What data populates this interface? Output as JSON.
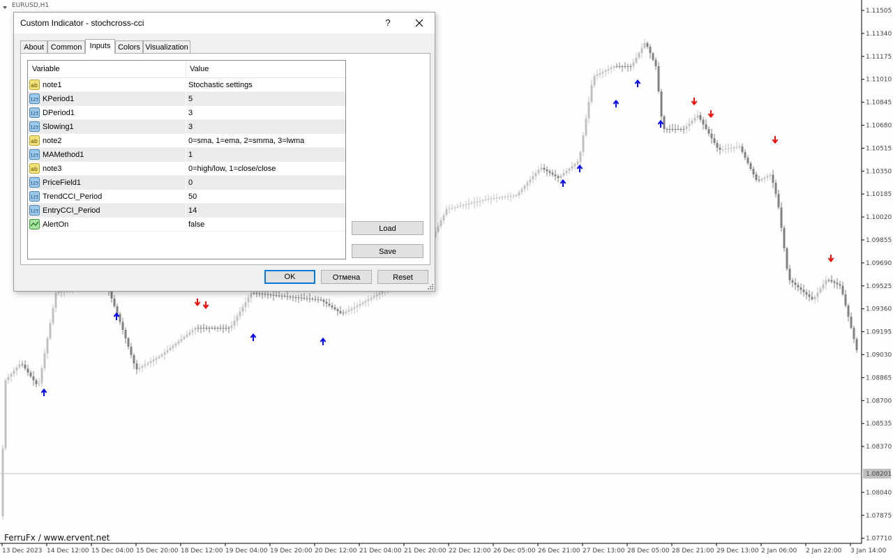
{
  "chart": {
    "symbol_label": "EURUSD,H1",
    "watermark": "FerruFx / www.ervent.net",
    "current_price": "1.08201",
    "price_labels": [
      "1.11505",
      "1.11340",
      "1.11175",
      "1.11010",
      "1.10845",
      "1.10680",
      "1.10515",
      "1.10350",
      "1.10185",
      "1.10020",
      "1.09855",
      "1.09690",
      "1.09525",
      "1.09360",
      "1.09195",
      "1.09030",
      "1.08865",
      "1.08700",
      "1.08535",
      "1.08370",
      "1.08040",
      "1.07875",
      "1.07710"
    ],
    "time_labels": [
      "13 Dec 2023",
      "14 Dec 12:00",
      "15 Dec 04:00",
      "15 Dec 20:00",
      "18 Dec 12:00",
      "19 Dec 04:00",
      "19 Dec 20:00",
      "20 Dec 12:00",
      "21 Dec 04:00",
      "21 Dec 20:00",
      "22 Dec 12:00",
      "26 Dec 05:00",
      "26 Dec 21:00",
      "27 Dec 13:00",
      "28 Dec 05:00",
      "28 Dec 21:00",
      "29 Dec 13:00",
      "2 Jan 06:00",
      "2 Jan 22:00",
      "3 Jan 14:00"
    ],
    "colors": {
      "background": "#fefefe",
      "up_candle": "#c0c0c0",
      "down_candle": "#808080",
      "buy_arrow": "#0000ff",
      "sell_arrow": "#ff0000",
      "bid_line": "#c0c0c0"
    },
    "buy_arrow_icon": "arrow-up-icon",
    "sell_arrow_icon": "arrow-down-icon"
  },
  "dialog": {
    "title": "Custom Indicator - stochcross-cci",
    "help_label": "?",
    "close_icon": "close-icon",
    "tabs": [
      "About",
      "Common",
      "Inputs",
      "Colors",
      "Visualization"
    ],
    "active_tab": "Inputs",
    "columns": {
      "variable": "Variable",
      "value": "Value"
    },
    "rows": [
      {
        "type": "ab",
        "name": "note1",
        "value": "Stochastic settings"
      },
      {
        "type": "123",
        "name": "KPeriod1",
        "value": "5"
      },
      {
        "type": "123",
        "name": "DPeriod1",
        "value": "3"
      },
      {
        "type": "123",
        "name": "Slowing1",
        "value": "3"
      },
      {
        "type": "ab",
        "name": "note2",
        "value": "0=sma, 1=ema, 2=smma, 3=lwma"
      },
      {
        "type": "123",
        "name": "MAMethod1",
        "value": "1"
      },
      {
        "type": "ab",
        "name": "note3",
        "value": "0=high/low, 1=close/close"
      },
      {
        "type": "123",
        "name": "PriceField1",
        "value": "0"
      },
      {
        "type": "123",
        "name": "TrendCCI_Period",
        "value": "50"
      },
      {
        "type": "123",
        "name": "EntryCCI_Period",
        "value": "14"
      },
      {
        "type": "bool",
        "name": "AlertOn",
        "value": "false"
      }
    ],
    "buttons": {
      "load": "Load",
      "save": "Save",
      "ok": "OK",
      "cancel": "Отмена",
      "reset": "Reset"
    }
  }
}
